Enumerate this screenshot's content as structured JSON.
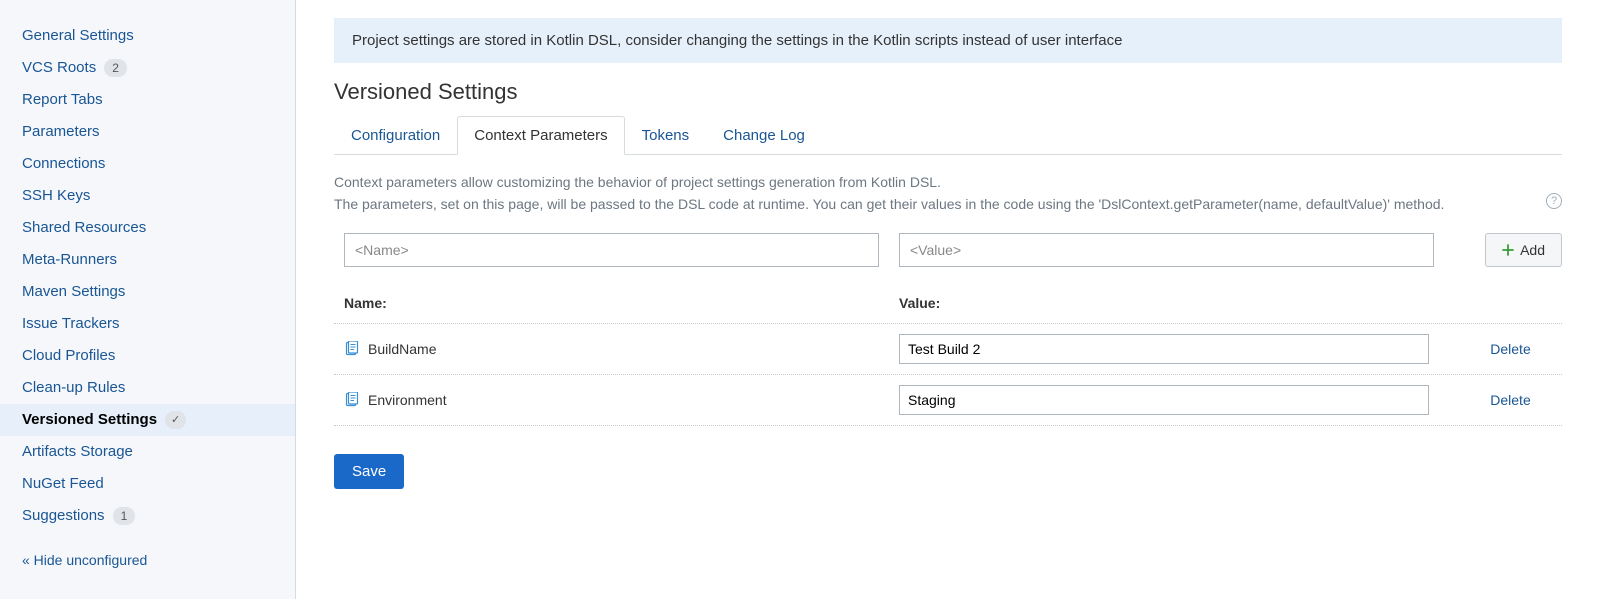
{
  "sidebar": {
    "items": [
      {
        "label": "General Settings",
        "badge": null
      },
      {
        "label": "VCS Roots",
        "badge": "2"
      },
      {
        "label": "Report Tabs",
        "badge": null
      },
      {
        "label": "Parameters",
        "badge": null
      },
      {
        "label": "Connections",
        "badge": null
      },
      {
        "label": "SSH Keys",
        "badge": null
      },
      {
        "label": "Shared Resources",
        "badge": null
      },
      {
        "label": "Meta-Runners",
        "badge": null
      },
      {
        "label": "Maven Settings",
        "badge": null
      },
      {
        "label": "Issue Trackers",
        "badge": null
      },
      {
        "label": "Cloud Profiles",
        "badge": null
      },
      {
        "label": "Clean-up Rules",
        "badge": null
      },
      {
        "label": "Versioned Settings",
        "badge": null,
        "edited": "✓",
        "selected": true
      },
      {
        "label": "Artifacts Storage",
        "badge": null
      },
      {
        "label": "NuGet Feed",
        "badge": null
      },
      {
        "label": "Suggestions",
        "badge": "1"
      }
    ],
    "hide_link": "« Hide unconfigured"
  },
  "main": {
    "notice": "Project settings are stored in Kotlin DSL, consider changing the settings in the Kotlin scripts instead of user interface",
    "title": "Versioned Settings",
    "tabs": [
      {
        "label": "Configuration",
        "active": false
      },
      {
        "label": "Context Parameters",
        "active": true
      },
      {
        "label": "Tokens",
        "active": false
      },
      {
        "label": "Change Log",
        "active": false
      }
    ],
    "description_line1": "Context parameters allow customizing the behavior of project settings generation from Kotlin DSL.",
    "description_line2": "The parameters, set on this page, will be passed to the DSL code at runtime. You can get their values in the code using the 'DslContext.getParameter(name, defaultValue)' method.",
    "add_row": {
      "name_placeholder": "<Name>",
      "value_placeholder": "<Value>",
      "add_label": "Add"
    },
    "columns": {
      "name": "Name:",
      "value": "Value:"
    },
    "params": [
      {
        "name": "BuildName",
        "value": "Test Build 2",
        "delete_label": "Delete"
      },
      {
        "name": "Environment",
        "value": "Staging",
        "delete_label": "Delete"
      }
    ],
    "save_label": "Save"
  }
}
